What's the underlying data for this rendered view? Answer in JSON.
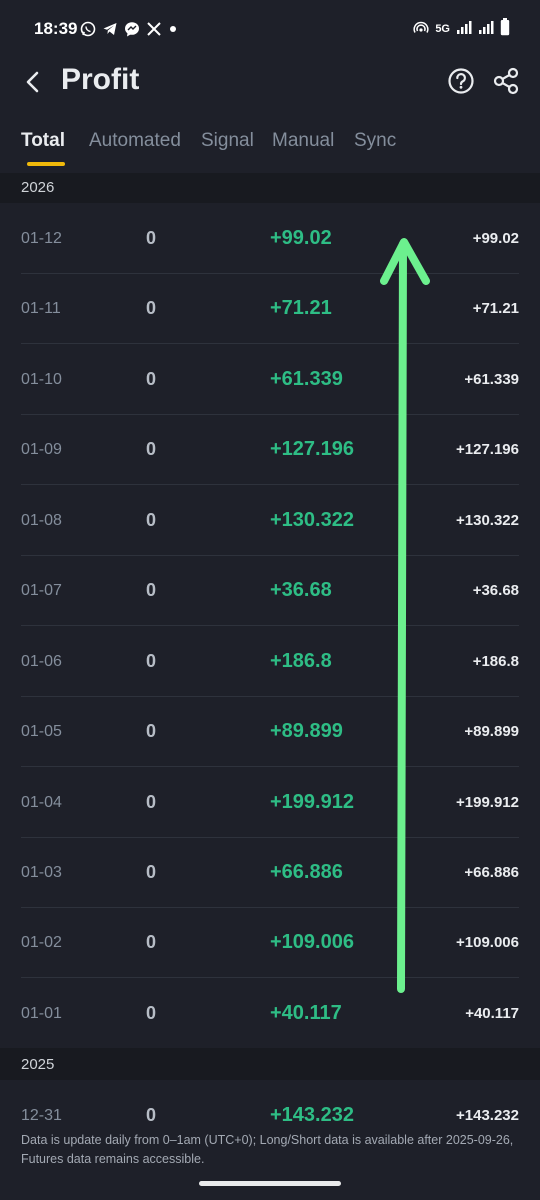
{
  "status_bar": {
    "time": "18:39",
    "network": "5G",
    "left_icons": [
      "whatsapp-icon",
      "telegram-icon",
      "messenger-icon",
      "x-icon",
      "dot-icon"
    ],
    "right_icons": [
      "hotspot-icon",
      "signal-icon",
      "signal-icon",
      "battery-icon"
    ]
  },
  "header": {
    "title": "Profit"
  },
  "tabs": [
    {
      "label": "Total",
      "active": true
    },
    {
      "label": "Automated",
      "active": false
    },
    {
      "label": "Signal",
      "active": false
    },
    {
      "label": "Manual",
      "active": false
    },
    {
      "label": "Sync",
      "active": false
    }
  ],
  "sections": [
    {
      "year": "2026",
      "rows": [
        {
          "date": "01-12",
          "count": "0",
          "profit": "+99.02",
          "total": "+99.02"
        },
        {
          "date": "01-11",
          "count": "0",
          "profit": "+71.21",
          "total": "+71.21"
        },
        {
          "date": "01-10",
          "count": "0",
          "profit": "+61.339",
          "total": "+61.339"
        },
        {
          "date": "01-09",
          "count": "0",
          "profit": "+127.196",
          "total": "+127.196"
        },
        {
          "date": "01-08",
          "count": "0",
          "profit": "+130.322",
          "total": "+130.322"
        },
        {
          "date": "01-07",
          "count": "0",
          "profit": "+36.68",
          "total": "+36.68"
        },
        {
          "date": "01-06",
          "count": "0",
          "profit": "+186.8",
          "total": "+186.8"
        },
        {
          "date": "01-05",
          "count": "0",
          "profit": "+89.899",
          "total": "+89.899"
        },
        {
          "date": "01-04",
          "count": "0",
          "profit": "+199.912",
          "total": "+199.912"
        },
        {
          "date": "01-03",
          "count": "0",
          "profit": "+66.886",
          "total": "+66.886"
        },
        {
          "date": "01-02",
          "count": "0",
          "profit": "+109.006",
          "total": "+109.006"
        },
        {
          "date": "01-01",
          "count": "0",
          "profit": "+40.117",
          "total": "+40.117"
        }
      ]
    },
    {
      "year": "2025",
      "rows": [
        {
          "date": "12-31",
          "count": "0",
          "profit": "+143.232",
          "total": "+143.232"
        }
      ]
    }
  ],
  "footer_note": "Data is update daily from 0–1am (UTC+0); Long/Short data is available after 2025-09-26, Futures data remains accessible.",
  "colors": {
    "background": "#1e2029",
    "section_header": "#181a20",
    "profit_positive": "#2ebd85",
    "tab_indicator": "#f0b90b",
    "annotation_arrow": "#6cf08e"
  }
}
